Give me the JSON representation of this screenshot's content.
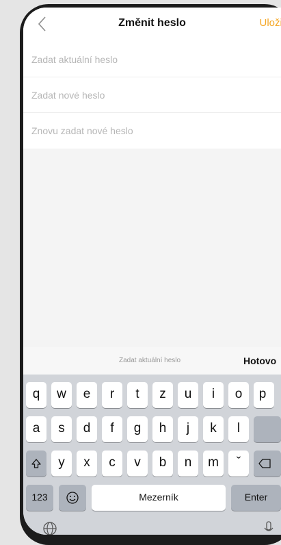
{
  "nav": {
    "title": "Změnit heslo",
    "save_label": "Uložit"
  },
  "fields": [
    {
      "placeholder": "Zadat aktuální heslo"
    },
    {
      "placeholder": "Zadat nové heslo"
    },
    {
      "placeholder": "Znovu zadat nové heslo"
    }
  ],
  "keyboard": {
    "toolbar_hint": "Zadat aktuální heslo",
    "done_label": "Hotovo",
    "row1": [
      "q",
      "w",
      "e",
      "r",
      "t",
      "z",
      "u",
      "i",
      "o",
      "p"
    ],
    "row2": [
      "a",
      "s",
      "d",
      "f",
      "g",
      "h",
      "j",
      "k",
      "l"
    ],
    "row3": [
      "y",
      "x",
      "c",
      "v",
      "b",
      "n",
      "m",
      "ˇ"
    ],
    "numbers_label": "123",
    "space_label": "Mezerník",
    "enter_label": "Enter"
  },
  "colors": {
    "accent": "#f5a623",
    "keyboard_bg": "#d1d4d9"
  }
}
